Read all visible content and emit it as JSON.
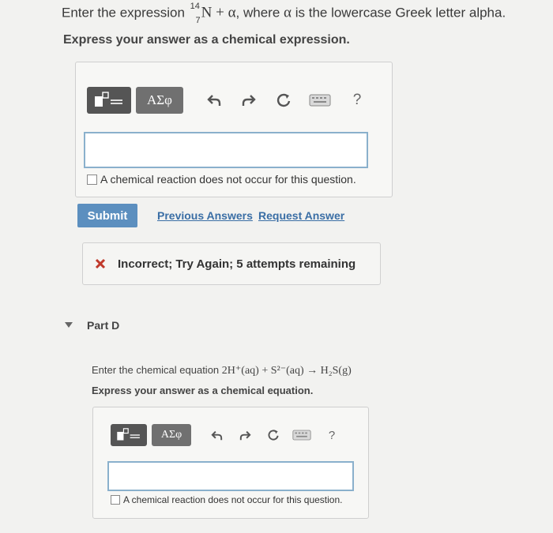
{
  "question": {
    "prefix": "Enter the expression ",
    "iso_mass": "14",
    "iso_atomic": "7",
    "iso_symbol": "N",
    "plus": "+",
    "alpha": "α",
    "suffix": ", where ",
    "alpha2": "α",
    "suffix2": " is the lowercase Greek letter alpha.",
    "instruction": "Express your answer as a chemical expression."
  },
  "toolbar": {
    "greek_label": "ΑΣφ",
    "help_label": "?"
  },
  "answer": {
    "value": "",
    "no_reaction_label": "A chemical reaction does not occur for this question."
  },
  "actions": {
    "submit_label": "Submit",
    "previous_answers_label": "Previous Answers",
    "request_answer_label": "Request Answer"
  },
  "feedback": {
    "text": "Incorrect; Try Again; 5 attempts remaining"
  },
  "part_d": {
    "title": "Part D",
    "prompt_prefix": "Enter the chemical equation ",
    "equation": "2H⁺(aq) + S²⁻(aq) → H₂S(g)",
    "instruction": "Express your answer as a chemical equation.",
    "greek_label": "ΑΣφ",
    "help_label": "?",
    "answer_value": "",
    "no_reaction_label": "A chemical reaction does not occur for this question."
  },
  "colors": {
    "accent": "#5c8fbf",
    "link": "#3a6ea5",
    "error": "#c0392b",
    "answer_border": "#8ab0cc"
  }
}
